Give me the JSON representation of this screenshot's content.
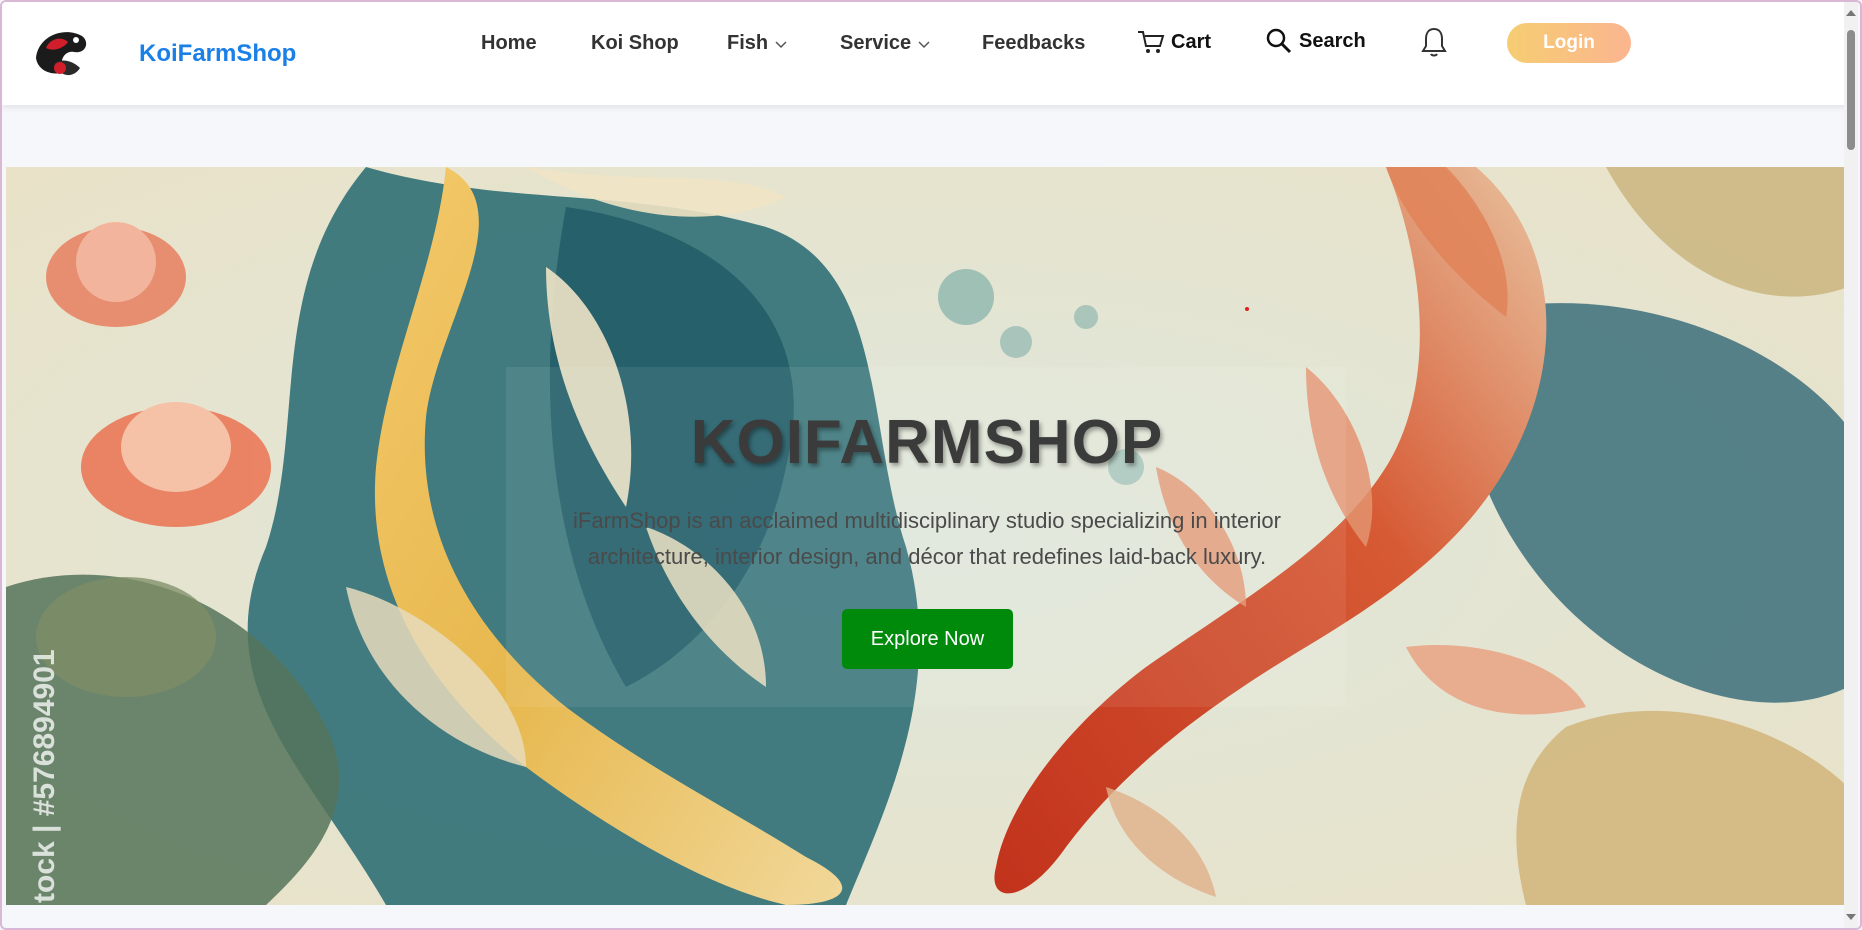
{
  "navbar": {
    "brand": "KoiFarmShop",
    "items": [
      {
        "label": "Home"
      },
      {
        "label": "Koi Shop"
      },
      {
        "label": "Fish"
      },
      {
        "label": "Service"
      },
      {
        "label": "Feedbacks"
      },
      {
        "label": "Cart"
      },
      {
        "label": "Search"
      }
    ],
    "login_label": "Login",
    "icons": [
      "logo-icon",
      "chevron-down-icon",
      "cart-icon",
      "search-icon",
      "bell-icon"
    ]
  },
  "hero": {
    "title": "KOIFARMSHOP",
    "description": "iFarmShop is an acclaimed multidisciplinary studio specializing in interior architecture, interior design, and décor that redefines laid-back luxury.",
    "button_label": "Explore Now",
    "watermark": "tock | #576894901"
  },
  "colors": {
    "brand": "#1a7fe6",
    "login_gradient_start": "#f6cd72",
    "login_gradient_end": "#fbb58f",
    "explore_button": "#008a0c"
  }
}
